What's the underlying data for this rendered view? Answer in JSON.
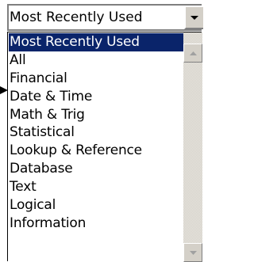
{
  "combo": {
    "value": "Most Recently Used",
    "button_icon": "chevron-down-icon"
  },
  "dropdown": {
    "items": [
      {
        "label": "Most Recently Used",
        "selected": true
      },
      {
        "label": "All",
        "selected": false
      },
      {
        "label": "Financial",
        "selected": false
      },
      {
        "label": "Date & Time",
        "selected": false
      },
      {
        "label": "Math & Trig",
        "selected": false
      },
      {
        "label": "Statistical",
        "selected": false
      },
      {
        "label": "Lookup & Reference",
        "selected": false
      },
      {
        "label": "Database",
        "selected": false
      },
      {
        "label": "Text",
        "selected": false
      },
      {
        "label": "Logical",
        "selected": false
      },
      {
        "label": "Information",
        "selected": false
      }
    ],
    "selected_color": "#0a246a",
    "scroll_up_icon": "arrow-up-icon",
    "scroll_down_icon": "arrow-down-icon"
  },
  "pointer_icon": "arrow-right-icon",
  "colors": {
    "selection": "#0a246a",
    "chrome": "#d4d0c8"
  }
}
